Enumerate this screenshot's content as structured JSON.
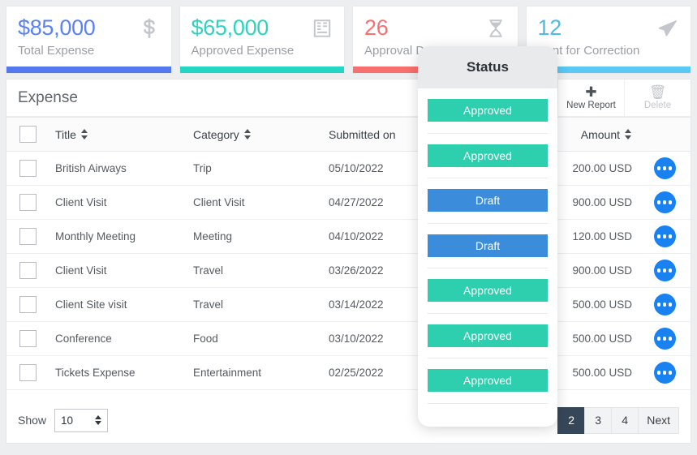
{
  "cards": [
    {
      "value": "$85,000",
      "label": "Total Expense",
      "value_color": "#5b82f5",
      "bar_color": "#5478f0",
      "icon": "dollar-icon"
    },
    {
      "value": "$65,000",
      "label": "Approved Expense",
      "value_color": "#2ed3c0",
      "bar_color": "#24d6c4",
      "icon": "clipboard-icon"
    },
    {
      "value": "26",
      "label": "Approval Due",
      "value_color": "#f8706f",
      "bar_color": "#f76f6f",
      "icon": "hourglass-icon"
    },
    {
      "value": "12",
      "label": "Sent for Correction",
      "value_color": "#4cbbe8",
      "bar_color": "#5bc8f5",
      "icon": "send-icon"
    }
  ],
  "toolbar": {
    "title": "Expense",
    "new_report_label": "New Report",
    "new_report_icon": "plus-icon",
    "delete_label": "Delete",
    "delete_icon": "trash-icon"
  },
  "table": {
    "columns": [
      "Title",
      "Category",
      "Submitted on",
      "Status",
      "Amount",
      ""
    ],
    "rows": [
      {
        "title": "British Airways",
        "category": "Trip",
        "submitted": "05/10/2022",
        "status": "Approved",
        "status_color": "#2ecfaf",
        "amount": "200.00 USD"
      },
      {
        "title": "Client Visit",
        "category": "Client Visit",
        "submitted": "04/27/2022",
        "status": "Approved",
        "status_color": "#2ecfaf",
        "amount": "900.00 USD"
      },
      {
        "title": "Monthly Meeting",
        "category": "Meeting",
        "submitted": "04/10/2022",
        "status": "Draft",
        "status_color": "#3b8ddb",
        "amount": "120.00 USD"
      },
      {
        "title": "Client Visit",
        "category": "Travel",
        "submitted": "03/26/2022",
        "status": "Draft",
        "status_color": "#3b8ddb",
        "amount": "900.00 USD"
      },
      {
        "title": "Client Site visit",
        "category": "Travel",
        "submitted": "03/14/2022",
        "status": "Approved",
        "status_color": "#2ecfaf",
        "amount": "500.00 USD"
      },
      {
        "title": "Conference",
        "category": "Food",
        "submitted": "03/10/2022",
        "status": "Approved",
        "status_color": "#2ecfaf",
        "amount": "500.00 USD"
      },
      {
        "title": "Tickets Expense",
        "category": "Entertainment",
        "submitted": "02/25/2022",
        "status": "Approved",
        "status_color": "#2ecfaf",
        "amount": "500.00 USD"
      }
    ]
  },
  "footer": {
    "show_label": "Show",
    "page_size": "10",
    "pages": [
      {
        "label": "2",
        "active": true
      },
      {
        "label": "3",
        "active": false
      },
      {
        "label": "4",
        "active": false
      },
      {
        "label": "Next",
        "active": false
      }
    ]
  },
  "status_popup": {
    "title": "Status",
    "items": [
      {
        "label": "Approved",
        "color": "#2ecfaf"
      },
      {
        "label": "Approved",
        "color": "#2ecfaf"
      },
      {
        "label": "Draft",
        "color": "#3b8ddb"
      },
      {
        "label": "Draft",
        "color": "#3b8ddb"
      },
      {
        "label": "Approved",
        "color": "#2ecfaf"
      },
      {
        "label": "Approved",
        "color": "#2ecfaf"
      },
      {
        "label": "Approved",
        "color": "#2ecfaf"
      }
    ]
  }
}
